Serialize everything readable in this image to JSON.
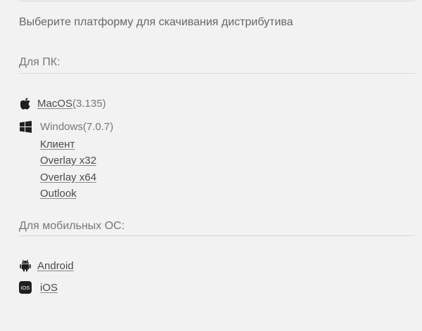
{
  "intro_text": "Выберите платформу для скачивания дистрибутива",
  "pc_section": {
    "title": "Для ПК:",
    "macos": {
      "icon": "apple-icon",
      "link_label": "MacOS",
      "version": "(3.135)"
    },
    "windows": {
      "icon": "windows-icon",
      "label": "Windows",
      "version": "(7.0.7)",
      "links": [
        "Клиент",
        "Overlay x32",
        "Overlay x64",
        "Outlook"
      ]
    }
  },
  "mobile_section": {
    "title": "Для мобильных ОС:",
    "android": {
      "icon": "android-icon",
      "link_label": "Android"
    },
    "ios": {
      "icon": "ios-icon",
      "badge_text": "iOS",
      "link_label": "iOS"
    }
  }
}
